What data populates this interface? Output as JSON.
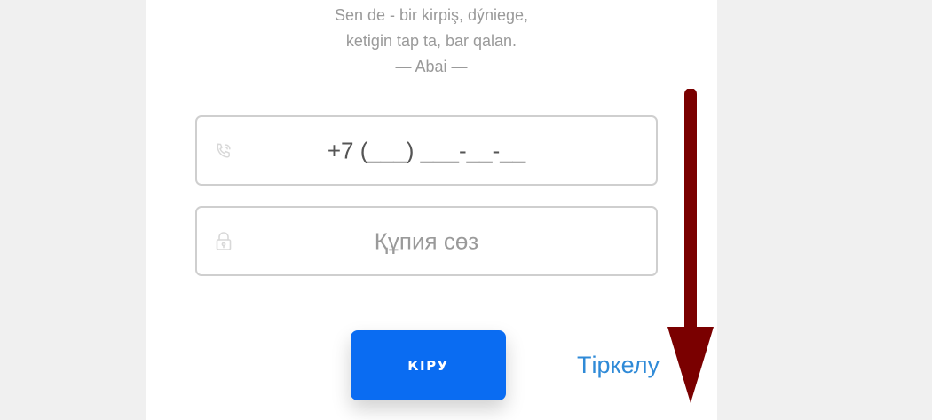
{
  "quote": {
    "line1": "Sen de - bir kirpiş, dýniege,",
    "line2": "ketigin tap ta, bar qalan.",
    "author": "—  Abai  —"
  },
  "phone_field": {
    "icon": "phone-icon",
    "value": "+7 (___) ___-__-__"
  },
  "password_field": {
    "icon": "lock-icon",
    "placeholder": "Құпия сөз"
  },
  "login_button": {
    "label": "КІРУ",
    "color": "#0a6cf2"
  },
  "register_link": {
    "label": "Тіркелу",
    "color": "#2f8ad7"
  },
  "annotation_arrow": {
    "icon": "down-arrow-icon",
    "color": "#7a0000"
  }
}
